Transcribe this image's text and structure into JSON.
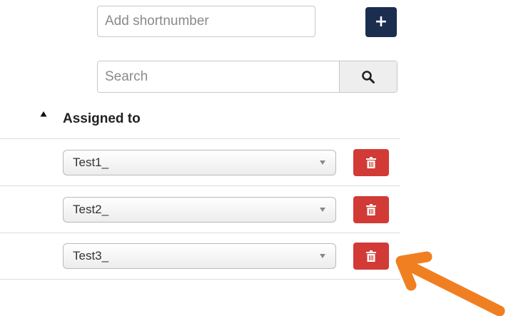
{
  "add_form": {
    "placeholder": "Add shortnumber",
    "add_button_label": "+"
  },
  "search": {
    "placeholder": "Search",
    "button_icon": "search-icon"
  },
  "table": {
    "sort_indicator": "caret-up-icon",
    "column_header": "Assigned to",
    "rows": [
      {
        "value": "Test1_",
        "delete_icon": "trash-icon"
      },
      {
        "value": "Test2_",
        "delete_icon": "trash-icon"
      },
      {
        "value": "Test3_",
        "delete_icon": "trash-icon"
      }
    ]
  },
  "annotation": {
    "arrow_icon": "pointer-arrow-icon",
    "arrow_color": "#f07f21"
  },
  "colors": {
    "add_button": "#1c2e4f",
    "delete_button": "#d23a36"
  }
}
